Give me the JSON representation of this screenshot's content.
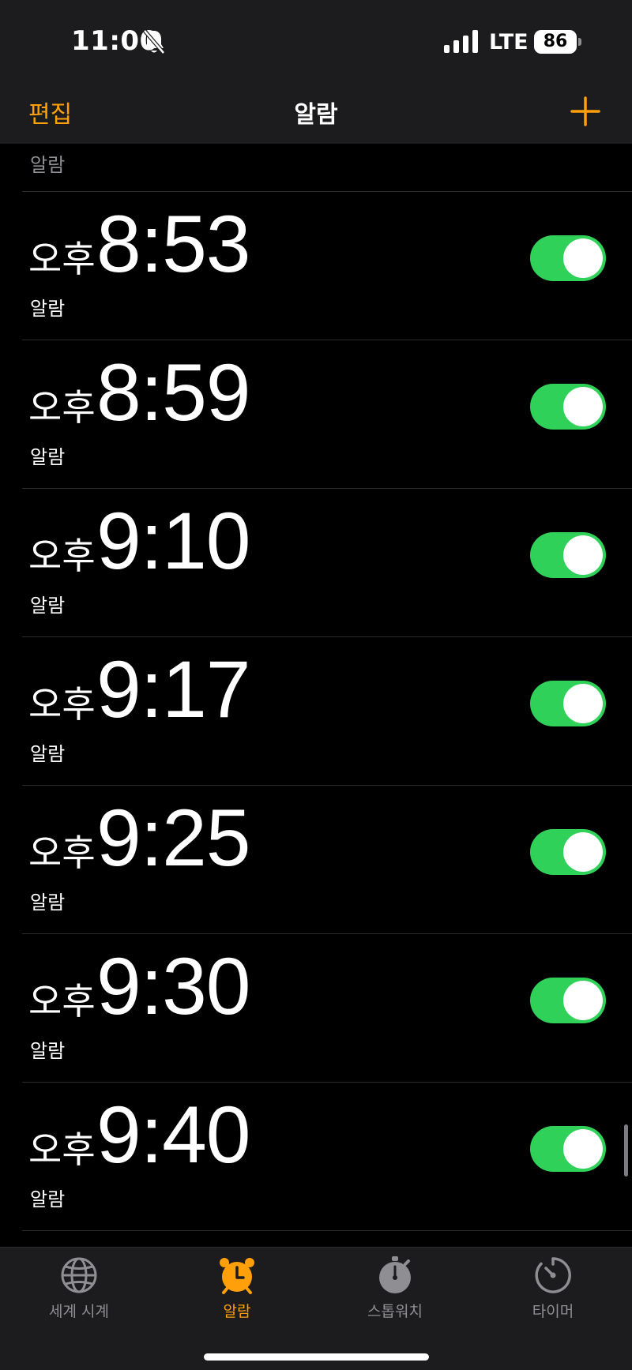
{
  "status_bar": {
    "time": "11:00",
    "network": "LTE",
    "battery": "86"
  },
  "nav": {
    "edit_label": "편집",
    "title": "알람",
    "add_icon": "plus-icon"
  },
  "partial_row": {
    "label": "알람"
  },
  "alarms": [
    {
      "ampm": "오후",
      "time": "8:53",
      "label": "알람",
      "enabled": true
    },
    {
      "ampm": "오후",
      "time": "8:59",
      "label": "알람",
      "enabled": true
    },
    {
      "ampm": "오후",
      "time": "9:10",
      "label": "알람",
      "enabled": true
    },
    {
      "ampm": "오후",
      "time": "9:17",
      "label": "알람",
      "enabled": true
    },
    {
      "ampm": "오후",
      "time": "9:25",
      "label": "알람",
      "enabled": true
    },
    {
      "ampm": "오후",
      "time": "9:30",
      "label": "알람",
      "enabled": true
    },
    {
      "ampm": "오후",
      "time": "9:40",
      "label": "알람",
      "enabled": true
    }
  ],
  "tabs": [
    {
      "label": "세계 시계",
      "icon": "globe-icon",
      "active": false
    },
    {
      "label": "알람",
      "icon": "alarm-clock-icon",
      "active": true
    },
    {
      "label": "스톱워치",
      "icon": "stopwatch-icon",
      "active": false
    },
    {
      "label": "타이머",
      "icon": "timer-icon",
      "active": false
    }
  ],
  "colors": {
    "accent": "#ff9f0a",
    "toggle_on": "#30d158",
    "background": "#000000",
    "bar_background": "#1c1c1e",
    "secondary_text": "#8e8e93"
  }
}
